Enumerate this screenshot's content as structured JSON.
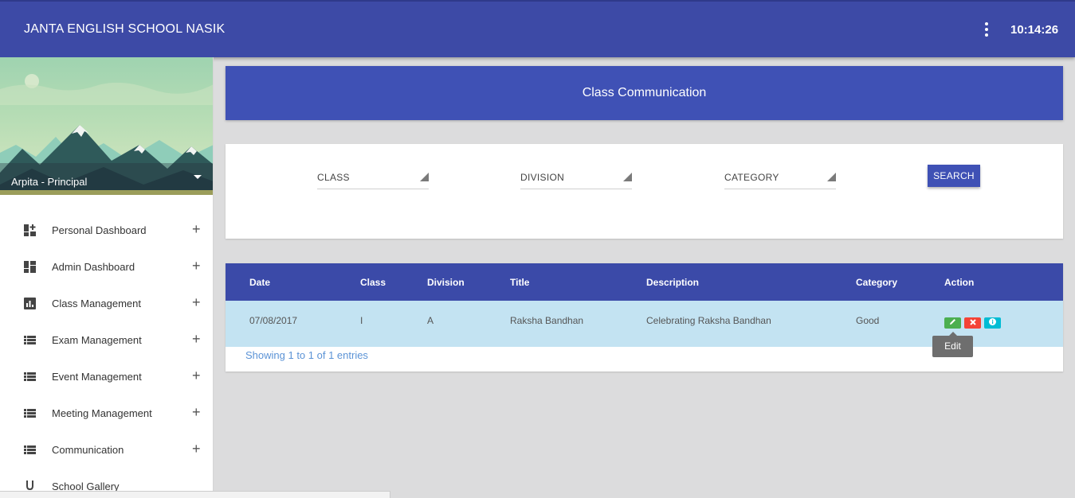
{
  "topbar": {
    "title": "JANTA ENGLISH SCHOOL NASIK",
    "menu_icon": "more-vert-icon",
    "time": "10:14:26"
  },
  "profile": {
    "name": "Arpita - Principal"
  },
  "sidebar": {
    "items": [
      {
        "label": "Personal Dashboard",
        "icon": "dashboard-plus-icon",
        "expand": "+"
      },
      {
        "label": "Admin Dashboard",
        "icon": "dashboard-icon",
        "expand": "+"
      },
      {
        "label": "Class Management",
        "icon": "chart-icon",
        "expand": "+"
      },
      {
        "label": "Exam Management",
        "icon": "list-icon",
        "expand": "+"
      },
      {
        "label": "Event Management",
        "icon": "list-icon",
        "expand": "+"
      },
      {
        "label": "Meeting Management",
        "icon": "list-icon",
        "expand": "+"
      },
      {
        "label": "Communication",
        "icon": "list-icon",
        "expand": "+"
      },
      {
        "label": "School Gallery",
        "icon": "underline-icon",
        "expand": ""
      }
    ]
  },
  "page": {
    "title": "Class Communication"
  },
  "filters": {
    "class_label": "CLASS",
    "division_label": "DIVISION",
    "category_label": "CATEGORY",
    "search_label": "SEARCH"
  },
  "table": {
    "columns": [
      "Date",
      "Class",
      "Division",
      "Title",
      "Description",
      "Category",
      "Action"
    ],
    "rows": [
      {
        "date": "07/08/2017",
        "class": "I",
        "division": "A",
        "title": "Raksha Bandhan",
        "description": "Celebrating Raksha Bandhan",
        "category": "Good"
      }
    ],
    "tooltip": "Edit",
    "info": "Showing 1 to 1 of 1 entries"
  },
  "colors": {
    "primary": "#3f51b5",
    "topbar": "#3d4aa6",
    "row_highlight": "#c3e3f2",
    "edit": "#4caf50",
    "delete": "#f44336",
    "info": "#00bcd4",
    "link": "#5b93d6"
  }
}
